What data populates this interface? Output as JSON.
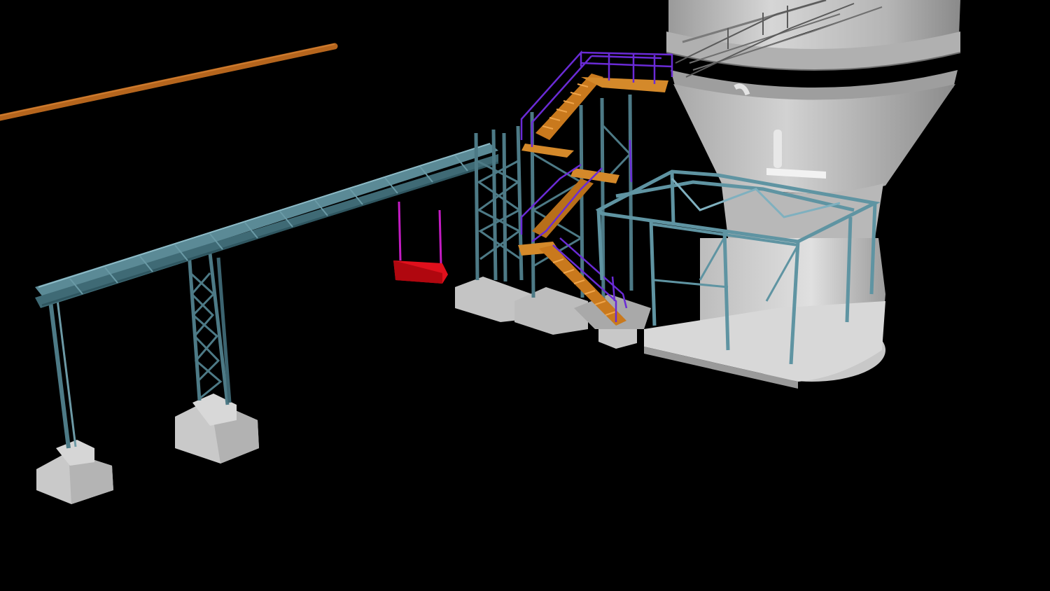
{
  "scene": {
    "background": "#000000",
    "colors": {
      "steel": "#4d7a86",
      "steel_light": "#7fb0bf",
      "concrete": "#c9c9c9",
      "concrete_shadow": "#8f8f8f",
      "silo": "#c4c4c4",
      "silo_dark": "#8a8a8a",
      "stair": "#d4892a",
      "handrail": "#6a2bd6",
      "chute": "#e0101c",
      "chute_rod": "#c41cc4",
      "pipe": "#b5651d"
    },
    "objects": [
      "orange-pipe",
      "conveyor-gallery",
      "support-trestle-left",
      "support-trestle-middle",
      "concrete-footing",
      "tower-structure",
      "staircase",
      "purple-handrails",
      "red-chute",
      "silo-hopper",
      "steel-frame-around-silo-base"
    ]
  }
}
